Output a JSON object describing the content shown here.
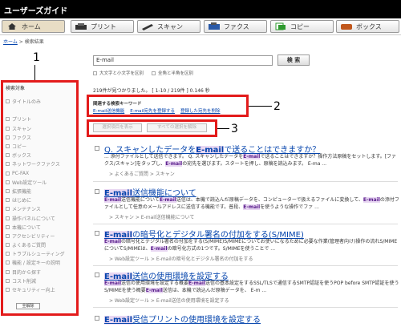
{
  "app": {
    "title": "ユーザーズガイド"
  },
  "nav": [
    {
      "label": "ホーム",
      "icon": "home-icon"
    },
    {
      "label": "プリント",
      "icon": "printer-icon"
    },
    {
      "label": "スキャン",
      "icon": "scanner-icon"
    },
    {
      "label": "ファクス",
      "icon": "fax-icon"
    },
    {
      "label": "コピー",
      "icon": "copy-icon"
    },
    {
      "label": "ボックス",
      "icon": "box-icon"
    }
  ],
  "breadcrumb": {
    "home": "ホーム",
    "sep": ">",
    "current": "検索結果"
  },
  "sidebar": {
    "heading": "検索対象",
    "items": [
      "タイトルのみ",
      "",
      "プリント",
      "スキャン",
      "ファクス",
      "コピー",
      "ボックス",
      "ネットワークファクス",
      "PC-FAX",
      "Web設定ツール",
      "拡張機能",
      "はじめに",
      "メンテナンス",
      "操作パネルについて",
      "本機について",
      "アクセシビリティー",
      "よくあるご質問",
      "トラブルシューティング",
      "機能 / 設定キーの説明",
      "目的から探す",
      "コスト削減",
      "セキュリティー向上"
    ],
    "clear_all": "全解除"
  },
  "search": {
    "value": "E-mail",
    "button": "検 索",
    "opt_case": "大文字と小文字を区別",
    "opt_width": "全角と半角を区別"
  },
  "hits": "219件が見つかりました。 [ 1-10 / 219件 ] 0.146 秒",
  "related": {
    "label": "関連する検索キーワード",
    "links": [
      "E-mail送信機能",
      "E-mail宛先を登録する",
      "登録した宛先を削除"
    ]
  },
  "select_buttons": {
    "show_selected": "選択項目を表示",
    "clear_selection": "すべての選択を解除"
  },
  "callouts": [
    "1",
    "2",
    "3"
  ],
  "results": [
    {
      "title_a": "Q. スキャンしたデータを",
      "title_hl": "E-mail",
      "title_b": "で送ることはできますか？",
      "snip_1a": "... 添付ファイルとして送信できます。 Q. スキャンしたデータを",
      "snip_1hl": "E-mail",
      "snip_1b": "で送ることはできますか？操作方法原稿をセットします。[ファクス/スキャン]をタップし、",
      "snip_2hl": "E-mail",
      "snip_2b": "の宛先を選びます。スタートを押し、原稿を読込みます。 E-ma ...",
      "path": "> よくあるご質問 > スキャン"
    },
    {
      "title_hl": "E-mail",
      "title_b": "送信機能について",
      "snip_1hl": "E-mail",
      "snip_1b": "送信機能について",
      "snip_1c": "E-mail",
      "snip_1d": "送信は、本機で読込んだ原稿データを、コンピューターで扱えるファイルに変換して、",
      "snip_2hl": "E-mail",
      "snip_2b": "の添付ファイルとして任意のメールアドレスに送信する機能です。普段、",
      "snip_2c": "E-mail",
      "snip_2d": "を使うような操作でファ ...",
      "path": "> スキャン > E-mail送信機能について"
    },
    {
      "title_hl": "E-mail",
      "title_b": "の暗号化とデジタル署名の付加をする(S/MIME)",
      "snip_1hl": "E-mail",
      "snip_1b": "の暗号化とデジタル署名の付加をする(S/MIME)S/MIMEについてお使いになるために必要な作業(管理者向け)操作の流れS/MIMEについてS/MIMEは、",
      "snip_1c": "E-mail",
      "snip_1d": "の暗号化方式の1つです。S/MIMEを使うことで ...",
      "path": "> Web設定ツール > E-mailの暗号化とデジタル署名の付加をする"
    },
    {
      "title_hl": "E-mail",
      "title_b": "送信の使用環境を設定する",
      "snip_1hl": "E-mail",
      "snip_1b": "送信の使用環境を設定する概要",
      "snip_1c": "E-mail",
      "snip_1d": "送信の基本設定をするSSL/TLSで通信するSMTP認証を使うPOP before SMTP認証を使うS/MIMEを使う概要",
      "snip_2hl": "E-mail",
      "snip_2b": "送信は、本機で読込んだ原稿データを、 E-m ...",
      "path": "> Web設定ツール > E-mail送信の使用環境を設定する"
    },
    {
      "title_hl": "E-mail",
      "title_b": "受信プリントの使用環境を設定する"
    }
  ]
}
